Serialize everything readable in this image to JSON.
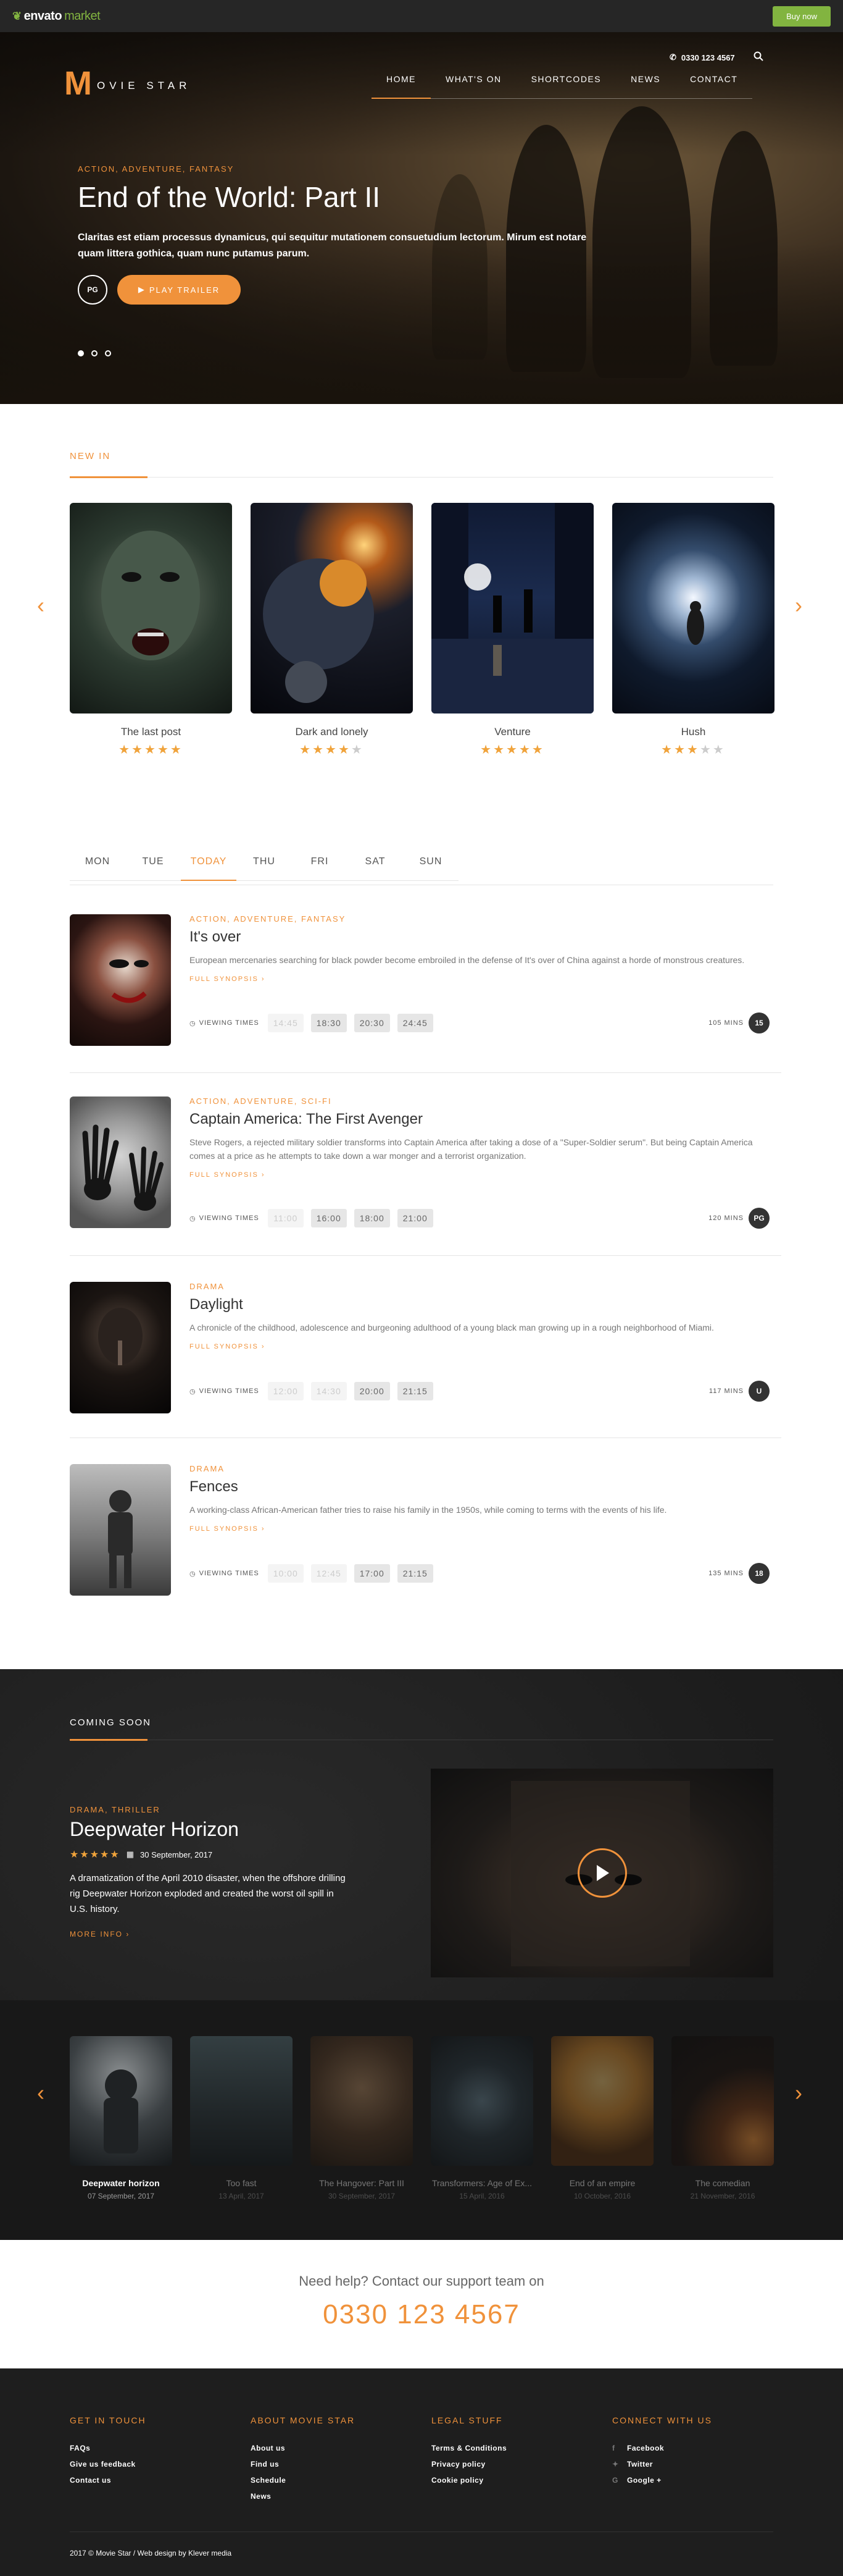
{
  "envato": {
    "logo": "envato",
    "logo_market": "market",
    "buy_now": "Buy now"
  },
  "header": {
    "phone": "0330 123 4567",
    "brand_m": "M",
    "brand_text": "OVIE STAR",
    "nav": [
      "HOME",
      "WHAT'S ON",
      "SHORTCODES",
      "NEWS",
      "CONTACT"
    ]
  },
  "hero": {
    "genres": "ACTION, ADVENTURE, FANTASY",
    "title": "End of the World: Part II",
    "description": "Claritas est etiam processus dynamicus, qui sequitur mutationem consuetudium lectorum. Mirum est notare quam littera gothica, quam nunc putamus parum.",
    "rating": "PG",
    "play_trailer": "PLAY TRAILER"
  },
  "new_in": {
    "title": "NEW IN",
    "cards": [
      {
        "title": "The last post",
        "stars": 5
      },
      {
        "title": "Dark and lonely",
        "stars": 4
      },
      {
        "title": "Venture",
        "stars": 5
      },
      {
        "title": "Hush",
        "stars": 3
      }
    ]
  },
  "schedule": {
    "days": [
      "MON",
      "TUE",
      "TODAY",
      "THU",
      "FRI",
      "SAT",
      "SUN"
    ],
    "viewing_label": "VIEWING TIMES",
    "synopsis_label": "FULL SYNOPSIS ›",
    "films": [
      {
        "genres": "ACTION, ADVENTURE, FANTASY",
        "title": "It's over",
        "description": "European mercenaries searching for black powder become embroiled in the defense of It's over of China against a horde of monstrous creatures.",
        "times": [
          "14:45",
          "18:30",
          "20:30",
          "24:45"
        ],
        "past": 1,
        "mins": "105 MINS",
        "rating": "15"
      },
      {
        "genres": "ACTION, ADVENTURE, SCI-FI",
        "title": "Captain America: The First Avenger",
        "description": "Steve Rogers, a rejected military soldier transforms into Captain America after taking a dose of a \"Super-Soldier serum\". But being Captain America comes at a price as he attempts to take down a war monger and a terrorist organization.",
        "times": [
          "11:00",
          "16:00",
          "18:00",
          "21:00"
        ],
        "past": 1,
        "mins": "120 MINS",
        "rating": "PG"
      },
      {
        "genres": "DRAMA",
        "title": "Daylight",
        "description": "A chronicle of the childhood, adolescence and burgeoning adulthood of a young black man growing up in a rough neighborhood of Miami.",
        "times": [
          "12:00",
          "14:30",
          "20:00",
          "21:15"
        ],
        "past": 2,
        "mins": "117 MINS",
        "rating": "U"
      },
      {
        "genres": "DRAMA",
        "title": "Fences",
        "description": "A working-class African-American father tries to raise his family in the 1950s, while coming to terms with the events of his life.",
        "times": [
          "10:00",
          "12:45",
          "17:00",
          "21:15"
        ],
        "past": 2,
        "mins": "135 MINS",
        "rating": "18"
      }
    ]
  },
  "coming_soon": {
    "title": "COMING SOON",
    "genres": "DRAMA, THRILLER",
    "film_title": "Deepwater Horizon",
    "stars": 5,
    "date": "30 September, 2017",
    "description": "A dramatization of the April 2010 disaster, when the offshore drilling rig Deepwater Horizon exploded and created the worst oil spill in U.S. history.",
    "more_info": "MORE INFO ›",
    "upcoming": [
      {
        "title": "Deepwater horizon",
        "date": "07 September, 2017"
      },
      {
        "title": "Too fast",
        "date": "13 April, 2017"
      },
      {
        "title": "The Hangover: Part III",
        "date": "30 September, 2017"
      },
      {
        "title": "Transformers: Age of Ex...",
        "date": "15 April, 2016"
      },
      {
        "title": "End of an empire",
        "date": "10 October, 2016"
      },
      {
        "title": "The comedian",
        "date": "21 November, 2016"
      }
    ]
  },
  "help": {
    "question": "Need help? Contact our support team on",
    "phone": "0330 123 4567"
  },
  "footer": {
    "columns": [
      {
        "title": "GET IN TOUCH",
        "links": [
          "FAQs",
          "Give us feedback",
          "Contact us"
        ]
      },
      {
        "title": "ABOUT MOVIE STAR",
        "links": [
          "About us",
          "Find us",
          "Schedule",
          "News"
        ]
      },
      {
        "title": "LEGAL STUFF",
        "links": [
          "Terms & Conditions",
          "Privacy policy",
          "Cookie policy"
        ]
      },
      {
        "title": "CONNECT WITH US",
        "links": [
          "Facebook",
          "Twitter",
          "Google +"
        ]
      }
    ],
    "copyright": "2017 © Movie Star / Web design by Klever media"
  },
  "colors": {
    "accent": "#f0923b",
    "envato_green": "#82b440",
    "dark": "#1e1e1e"
  }
}
